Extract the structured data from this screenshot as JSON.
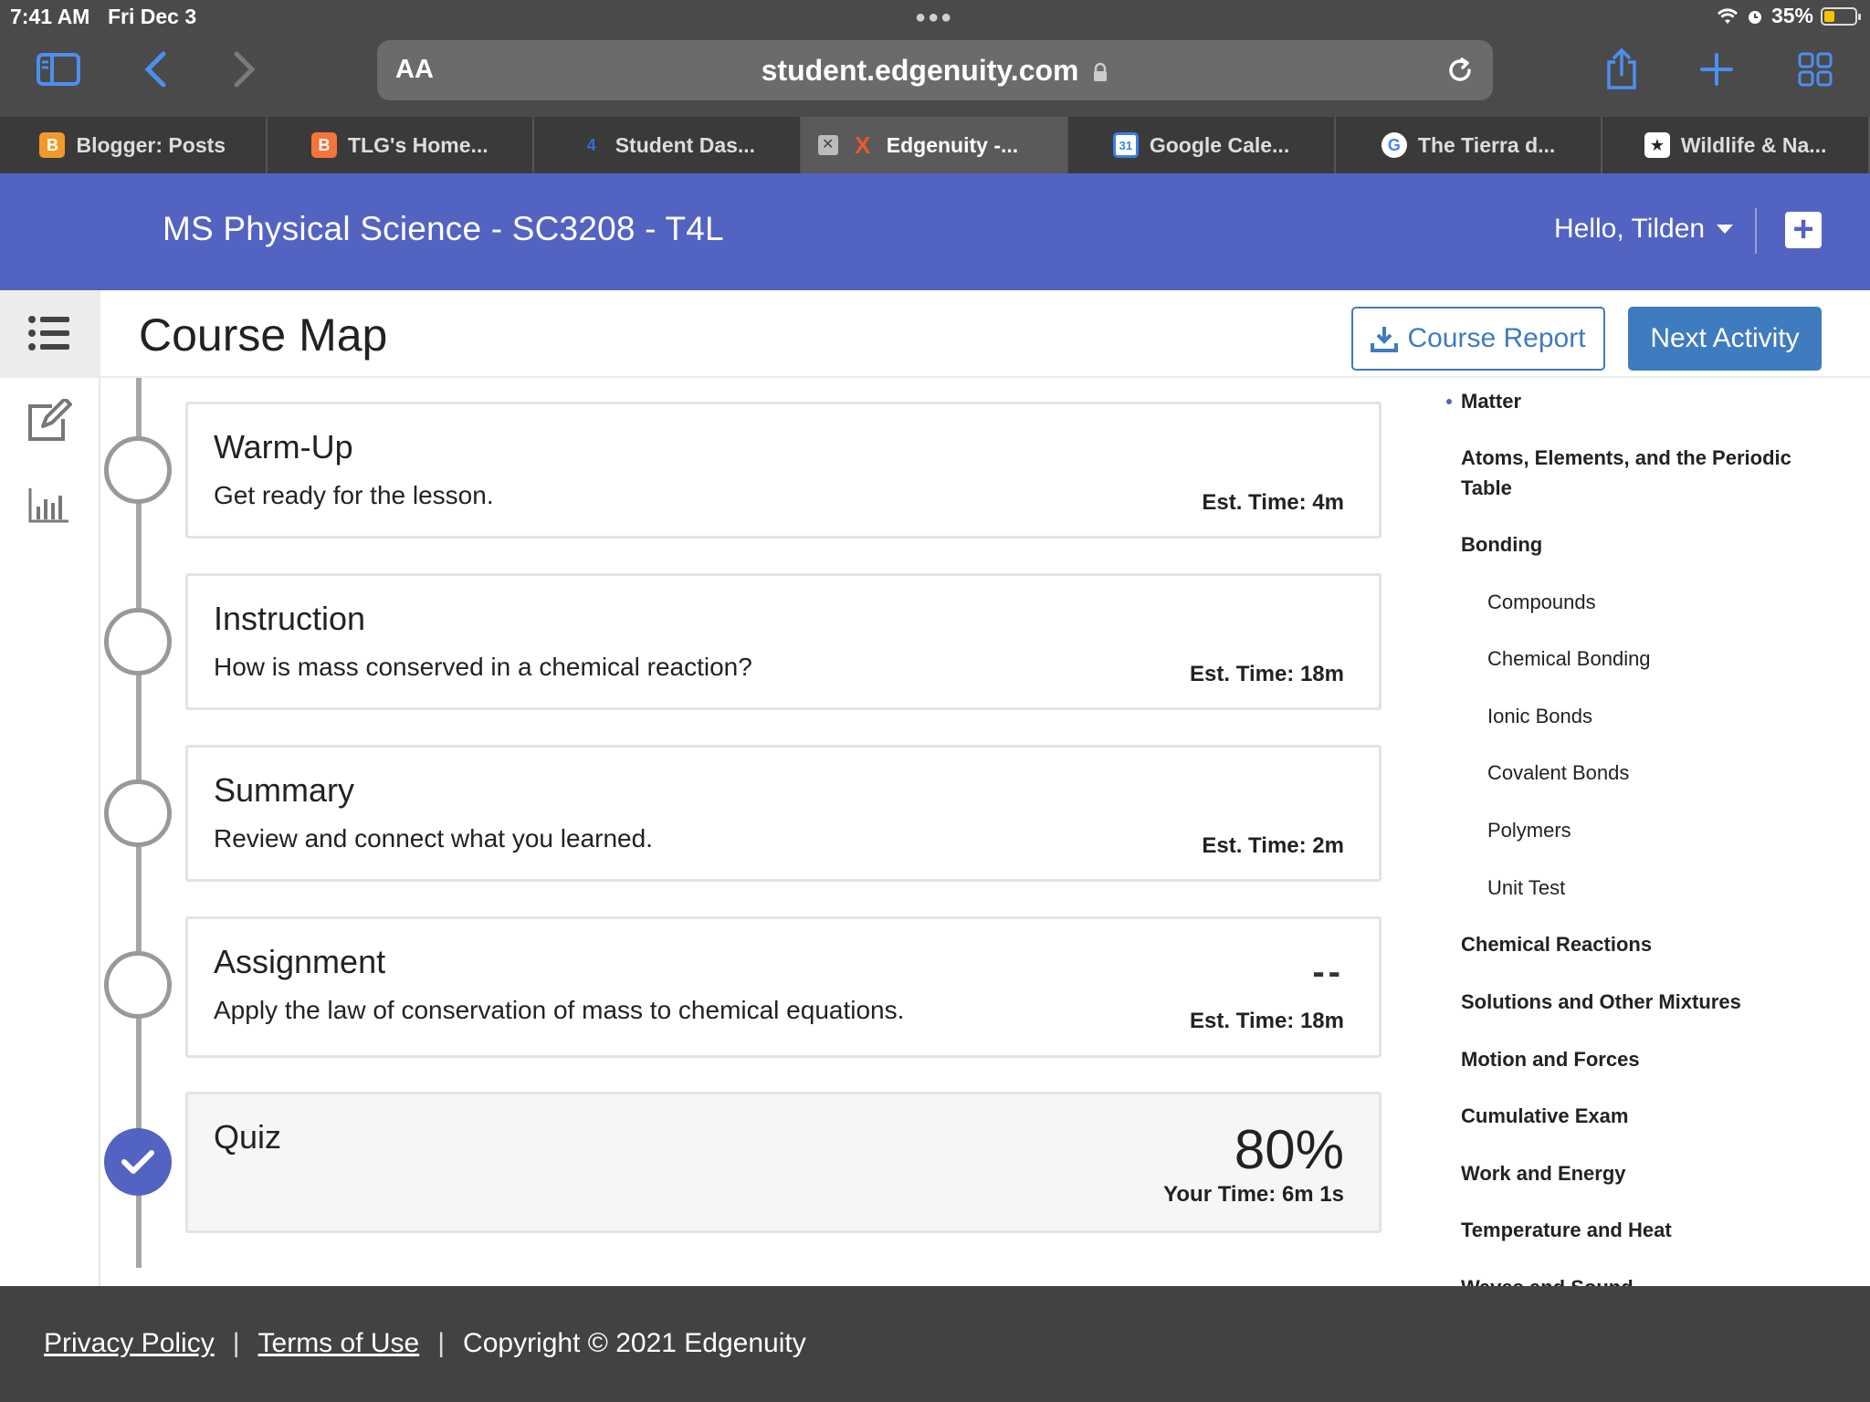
{
  "status": {
    "time": "7:41 AM",
    "date": "Fri Dec 3",
    "battery": "35%"
  },
  "browser": {
    "aa": "AA",
    "url": "student.edgenuity.com",
    "tabs": [
      {
        "label": "Blogger: Posts",
        "icon": "blogger-icon",
        "fav_text": "B",
        "fav_color": "#f19a2c"
      },
      {
        "label": "TLG's Home...",
        "icon": "blogger-icon",
        "fav_text": "B",
        "fav_color": "#f4753b"
      },
      {
        "label": "Student Das...",
        "icon": "canvas-icon",
        "fav_text": "4",
        "fav_color": "#2f6fd6"
      },
      {
        "label": "Edgenuity -...",
        "icon": "edgenuity-icon",
        "fav_text": "X",
        "fav_color": "#e85b2a"
      },
      {
        "label": "Google Cale...",
        "icon": "google-calendar-icon",
        "fav_text": "31",
        "fav_color": "#3d7ee8"
      },
      {
        "label": "The Tierra d...",
        "icon": "google-icon",
        "fav_text": "G",
        "fav_color": "#ffffff"
      },
      {
        "label": "Wildlife & Na...",
        "icon": "wildlife-icon",
        "fav_text": "★",
        "fav_color": "#ffffff"
      }
    ]
  },
  "app": {
    "course_title": "MS Physical Science - SC3208 - T4L",
    "greeting": "Hello, Tilden",
    "page_title": "Course Map",
    "course_report_label": "Course Report",
    "next_activity_label": "Next Activity",
    "accent_color": "#5363c2"
  },
  "activities": [
    {
      "title": "Warm-Up",
      "desc": "Get ready for the lesson.",
      "est": "Est. Time: 4m",
      "status": "not-started"
    },
    {
      "title": "Instruction",
      "desc": "How is mass conserved in a chemical reaction?",
      "est": "Est. Time: 18m",
      "status": "not-started"
    },
    {
      "title": "Summary",
      "desc": "Review and connect what you learned.",
      "est": "Est. Time: 2m",
      "status": "not-started"
    },
    {
      "title": "Assignment",
      "desc": "Apply the law of conservation of mass to chemical equations.",
      "est": "Est. Time: 18m",
      "score": "--",
      "status": "not-started"
    },
    {
      "title": "Quiz",
      "score": "80%",
      "your_time": "Your Time: 6m 1s",
      "status": "completed"
    }
  ],
  "outline": [
    {
      "label": "Matter",
      "level": 1,
      "current": true
    },
    {
      "label": "Atoms, Elements, and the Periodic Table",
      "level": 1
    },
    {
      "label": "Bonding",
      "level": 1
    },
    {
      "label": "Compounds",
      "level": 2
    },
    {
      "label": "Chemical Bonding",
      "level": 2
    },
    {
      "label": "Ionic Bonds",
      "level": 2
    },
    {
      "label": "Covalent Bonds",
      "level": 2
    },
    {
      "label": "Polymers",
      "level": 2
    },
    {
      "label": "Unit Test",
      "level": 2
    },
    {
      "label": "Chemical Reactions",
      "level": 1
    },
    {
      "label": "Solutions and Other Mixtures",
      "level": 1
    },
    {
      "label": "Motion and Forces",
      "level": 1
    },
    {
      "label": "Cumulative Exam",
      "level": 1
    },
    {
      "label": "Work and Energy",
      "level": 1
    },
    {
      "label": "Temperature and Heat",
      "level": 1
    },
    {
      "label": "Waves and Sound",
      "level": 1
    }
  ],
  "footer": {
    "privacy": "Privacy Policy",
    "terms": "Terms of Use",
    "separator": "|",
    "copyright": "Copyright © 2021 Edgenuity"
  }
}
